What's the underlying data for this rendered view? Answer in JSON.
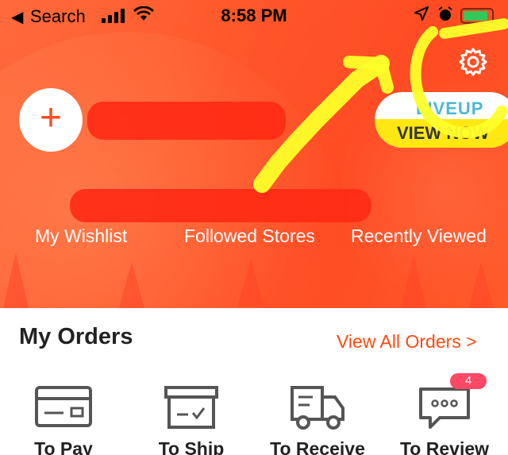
{
  "status_bar": {
    "back_label": "◀",
    "carrier": "Search",
    "time": "8:58 PM"
  },
  "header": {
    "promo": {
      "brand": "LIVEUP",
      "cta": "VIEW NOW"
    },
    "quick_links": [
      {
        "label": "My Wishlist"
      },
      {
        "label": "Followed Stores"
      },
      {
        "label": "Recently Viewed"
      }
    ]
  },
  "orders": {
    "title": "My Orders",
    "view_all": "View All Orders >",
    "items": [
      {
        "label": "To Pay",
        "icon": "card-icon"
      },
      {
        "label": "To Ship",
        "icon": "box-icon"
      },
      {
        "label": "To Receive",
        "icon": "truck-icon"
      },
      {
        "label": "To Review",
        "icon": "chat-icon",
        "badge": "4"
      }
    ]
  },
  "colors": {
    "accent": "#ff4a22",
    "link": "#ff4a10",
    "badge": "#ff4766",
    "promo_yellow": "#ffe812",
    "scribble_yellow": "#ffff2a"
  }
}
